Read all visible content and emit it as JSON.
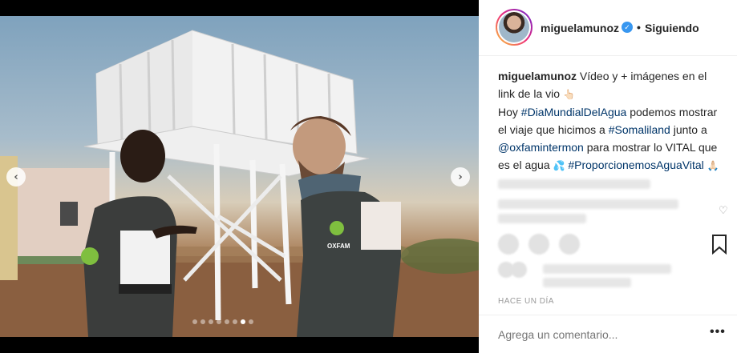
{
  "post": {
    "username": "miguelamunoz",
    "verified_icon": "verified-badge-icon",
    "follow_separator": "•",
    "follow_status": "Siguiendo",
    "caption": {
      "username": "miguelamunoz",
      "line1": "Vídeo y + imágenes en el link de la vio",
      "emoji1": "👆🏻",
      "pre_hashtag": "Hoy ",
      "hashtag1": "#DiaMundialDelAgua",
      "mid1": " podemos mostrar el viaje que hicimos a ",
      "hashtag2": "#Somaliland",
      "mid2": " junto a ",
      "mention": "@oxfamintermon",
      "mid3": " para mostrar lo VITAL que es el agua ",
      "emoji2": "💦",
      "hashtag3": "#ProporcionemosAguaVital",
      "emoji3": "🙏🏻"
    },
    "timestamp": "HACE UN DÍA",
    "comment_placeholder": "Agrega un comentario...",
    "more_label": "•••"
  },
  "media": {
    "prev_arrow": "‹",
    "next_arrow": "›",
    "carousel_count": 8,
    "carousel_active_index": 6,
    "vest_text": "OXFAM"
  },
  "icons": [
    "verified-badge-icon",
    "chevron-left-icon",
    "chevron-right-icon",
    "heart-icon",
    "bookmark-icon",
    "more-options-icon"
  ]
}
